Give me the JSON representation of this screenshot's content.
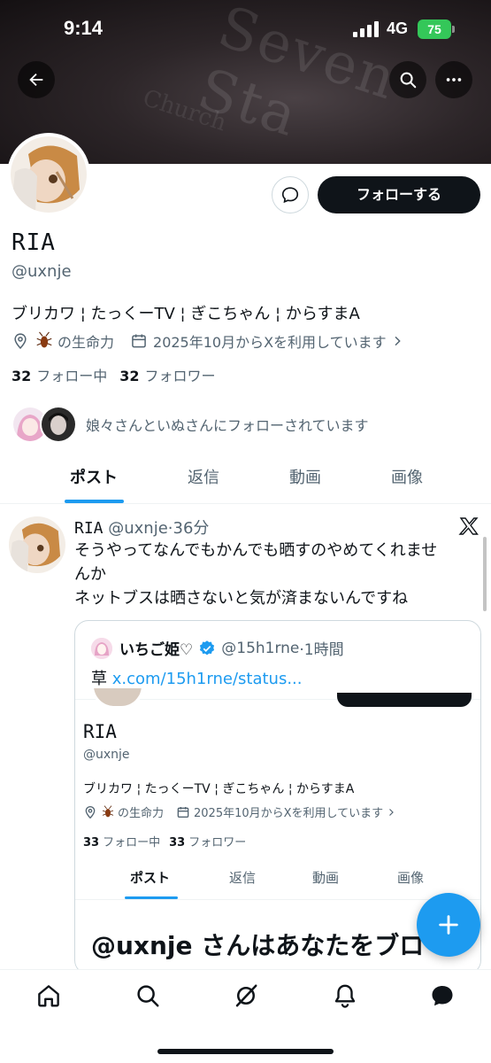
{
  "status_bar": {
    "time": "9:14",
    "network": "4G",
    "battery": "75"
  },
  "banner": {
    "script_text": "Seven Sta",
    "script_text2": "Church"
  },
  "profile": {
    "name": "RIA",
    "handle": "@uxnje",
    "bio": "ブリカワ ¦ たっくーTV ¦ ぎこちゃん ¦ からすまA",
    "location": "の生命力",
    "joined": "2025年10月からXを利用しています",
    "following_count": "32",
    "following_label": "フォロー中",
    "followers_count": "32",
    "followers_label": "フォロワー",
    "followed_by": "娘々さんといぬさんにフォローされています",
    "follow_button": "フォローする"
  },
  "tabs": [
    "ポスト",
    "返信",
    "動画",
    "画像"
  ],
  "post": {
    "author": "RIA",
    "handle": "@uxnje",
    "time": "·36分",
    "lines": [
      "そうやってなんでもかんでも晒すのやめてくれませ",
      "んか",
      "ネットブスは晒さないと気が済まないんですね"
    ]
  },
  "quote": {
    "name": "いちご姫♡",
    "handle": "@15h1rne",
    "time": "·1時間",
    "text_prefix": "草 ",
    "link": "x.com/15h1rne/status...",
    "shot": {
      "name": "RIA",
      "handle": "@uxnje",
      "bio": "ブリカワ ¦ たっくーTV ¦ ぎこちゃん ¦ からすまA",
      "location": "の生命力",
      "joined": "2025年10月からXを利用しています",
      "following_count": "33",
      "following_label": "フォロー中",
      "followers_count": "33",
      "followers_label": "フォロワー",
      "tabs": [
        "ポスト",
        "返信",
        "動画",
        "画像"
      ],
      "blocked": "@uxnje さんはあなたをブロ"
    }
  },
  "colors": {
    "accent": "#1d9bf0",
    "text": "#0f1419",
    "muted": "#536471"
  }
}
